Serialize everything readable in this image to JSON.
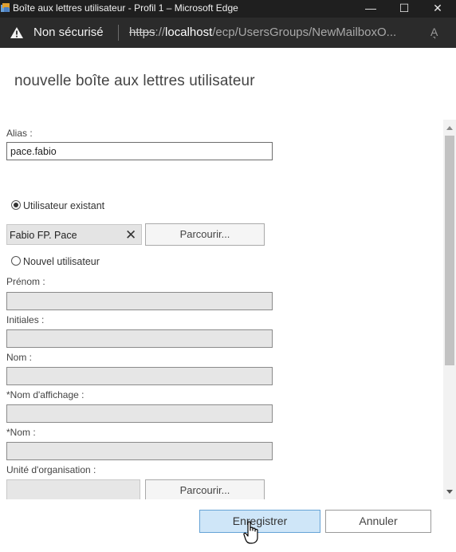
{
  "window": {
    "title": "Boîte aux lettres utilisateur - Profil 1 – Microsoft Edge",
    "minimize_glyph": "—",
    "maximize_glyph": "☐",
    "close_glyph": "✕"
  },
  "address_bar": {
    "security_label": "Non sécurisé",
    "url_protocol": "https",
    "url_sep": "://",
    "url_host": "localhost",
    "url_path": "/ecp/UsersGroups/NewMailboxO...",
    "reader_glyph": "A͉"
  },
  "page": {
    "title": "nouvelle boîte aux lettres utilisateur"
  },
  "form": {
    "alias_label": "Alias :",
    "alias_value": "pace.fabio",
    "existing_user_label": "Utilisateur existant",
    "existing_user_selected": true,
    "selected_user": "Fabio FP. Pace",
    "remove_glyph": "✕",
    "browse_label": "Parcourir...",
    "new_user_label": "Nouvel utilisateur",
    "first_name_label": "Prénom :",
    "initials_label": "Initiales :",
    "last_name_label": "Nom :",
    "display_name_label": "*Nom d'affichage :",
    "name_label": "*Nom :",
    "ou_label": "Unité d'organisation :",
    "ou_browse_label": "Parcourir..."
  },
  "footer": {
    "save_label": "Enregistrer",
    "cancel_label": "Annuler"
  },
  "icons": {
    "app": "edge-app-icon",
    "warning": "warning-triangle-icon",
    "cursor": "hand-pointer-icon"
  },
  "colors": {
    "titlebar_bg": "#1f1f1f",
    "addressbar_bg": "#2b2b2b",
    "save_button_bg": "#cfe6f8",
    "save_button_border": "#66a3d6"
  }
}
